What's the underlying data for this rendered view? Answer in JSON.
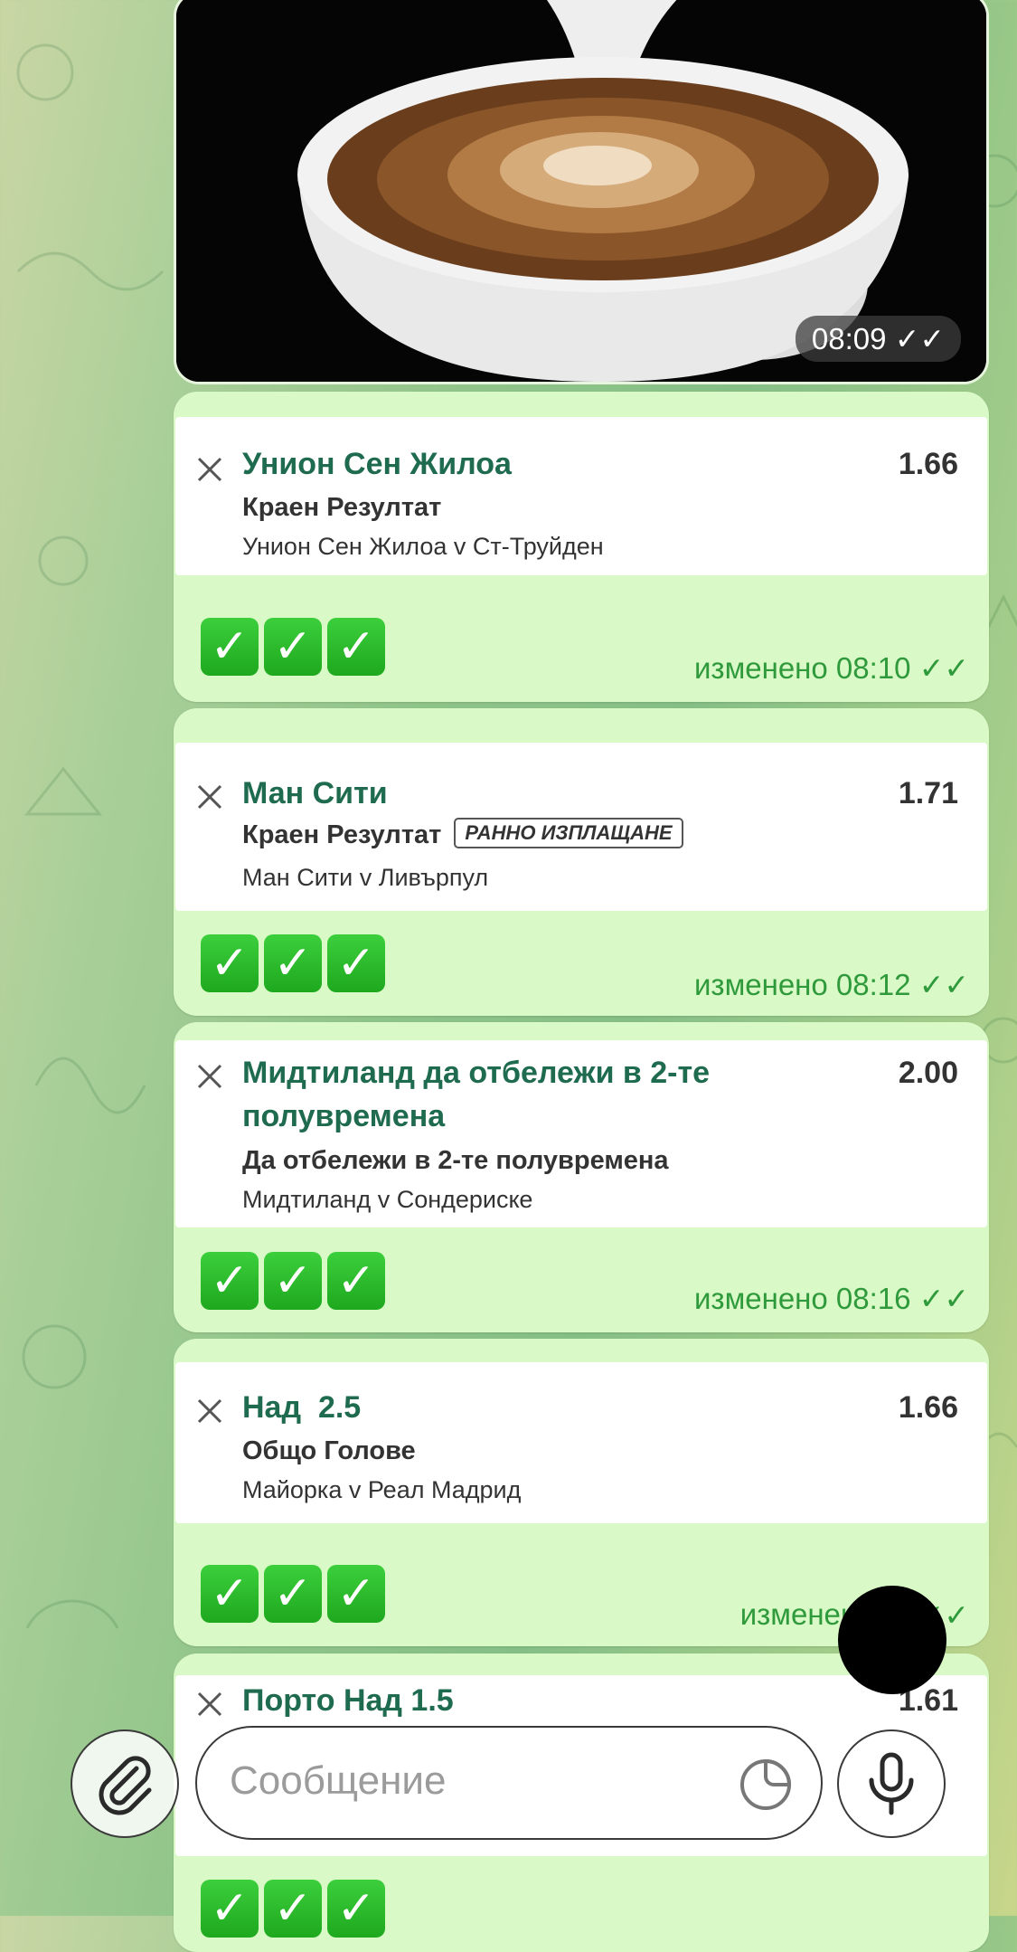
{
  "media": {
    "time": "08:09",
    "status_icon": "double-check-icon"
  },
  "bets": [
    {
      "team": "Унион Сен Жилоа",
      "odds": "1.66",
      "market": "Краен Резултат",
      "badge": "",
      "match": "Унион Сен Жилоа v Ст-Труйден",
      "checks": [
        "✓",
        "✓",
        "✓"
      ],
      "edited": "изменено 08:10"
    },
    {
      "team": "Ман Сити",
      "odds": "1.71",
      "market": "Краен Резултат",
      "badge": "РАННО ИЗПЛАЩАНЕ",
      "match": "Ман Сити v Ливърпул",
      "checks": [
        "✓",
        "✓",
        "✓"
      ],
      "edited": "изменено 08:12"
    },
    {
      "team": "Мидтиланд да отбележи в 2-те полувремена",
      "odds": "2.00",
      "market": "Да отбележи в 2-те полувремена",
      "badge": "",
      "match": "Мидтиланд v Сондерискe",
      "checks": [
        "✓",
        "✓",
        "✓"
      ],
      "edited": "изменено 08:16"
    },
    {
      "team": "Над  2.5",
      "odds": "1.66",
      "market": "Общо Голове",
      "badge": "",
      "match": "Майорка v Реал Мадрид",
      "checks": [
        "✓",
        "✓",
        "✓"
      ],
      "edited": "изменено 0"
    },
    {
      "team": "Порто Над 1.5",
      "odds": "1.61",
      "market": "",
      "badge": "",
      "match": "",
      "checks": [
        "✓",
        "✓",
        "✓"
      ],
      "edited": ""
    }
  ],
  "input": {
    "placeholder": "Сообщение"
  },
  "colors": {
    "bubble": "#d9f9c7",
    "team": "#1f6b4f",
    "edited": "#2f9a3b"
  }
}
